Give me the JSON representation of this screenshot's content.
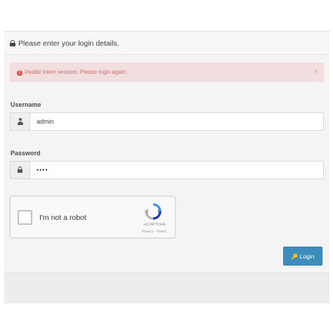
{
  "panel": {
    "heading": "Please enter your login details."
  },
  "alert": {
    "message": "Invalid token session. Please login again.",
    "icon": "exclamation-circle-icon",
    "close_symbol": "×",
    "colors": {
      "background": "#f2dede",
      "text": "#c86f6f"
    }
  },
  "form": {
    "username": {
      "label": "Username",
      "value": "admin",
      "icon": "user-icon"
    },
    "password": {
      "label": "Password",
      "value": "••••",
      "icon": "lock-icon"
    }
  },
  "captcha": {
    "label": "I'm not a robot",
    "brand": "reCAPTCHA",
    "links": "Privacy - Terms"
  },
  "login_button": {
    "label": "Login",
    "icon": "key-icon",
    "color": "#3c8dbc"
  }
}
